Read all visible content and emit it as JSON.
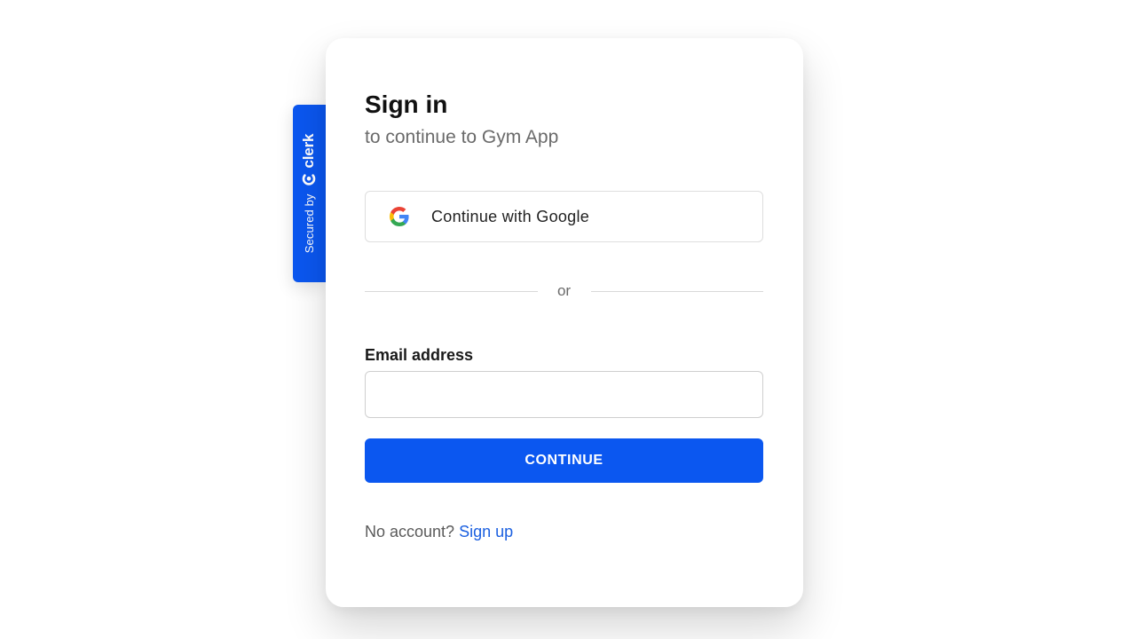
{
  "badge": {
    "secured_by": "Secured by",
    "brand": "clerk",
    "brand_icon": "clerk-logo-icon",
    "color": "#0b57f0"
  },
  "card": {
    "title": "Sign in",
    "subtitle": "to continue to Gym App"
  },
  "social": {
    "google_label": "Continue with Google",
    "google_icon": "google-icon"
  },
  "divider": {
    "text": "or"
  },
  "email": {
    "label": "Email address",
    "value": "",
    "placeholder": ""
  },
  "continue_button": {
    "label": "CONTINUE",
    "color": "#0b57f0"
  },
  "footer": {
    "prompt": "No account?",
    "link": "Sign up",
    "link_color": "#1a5fe0"
  }
}
